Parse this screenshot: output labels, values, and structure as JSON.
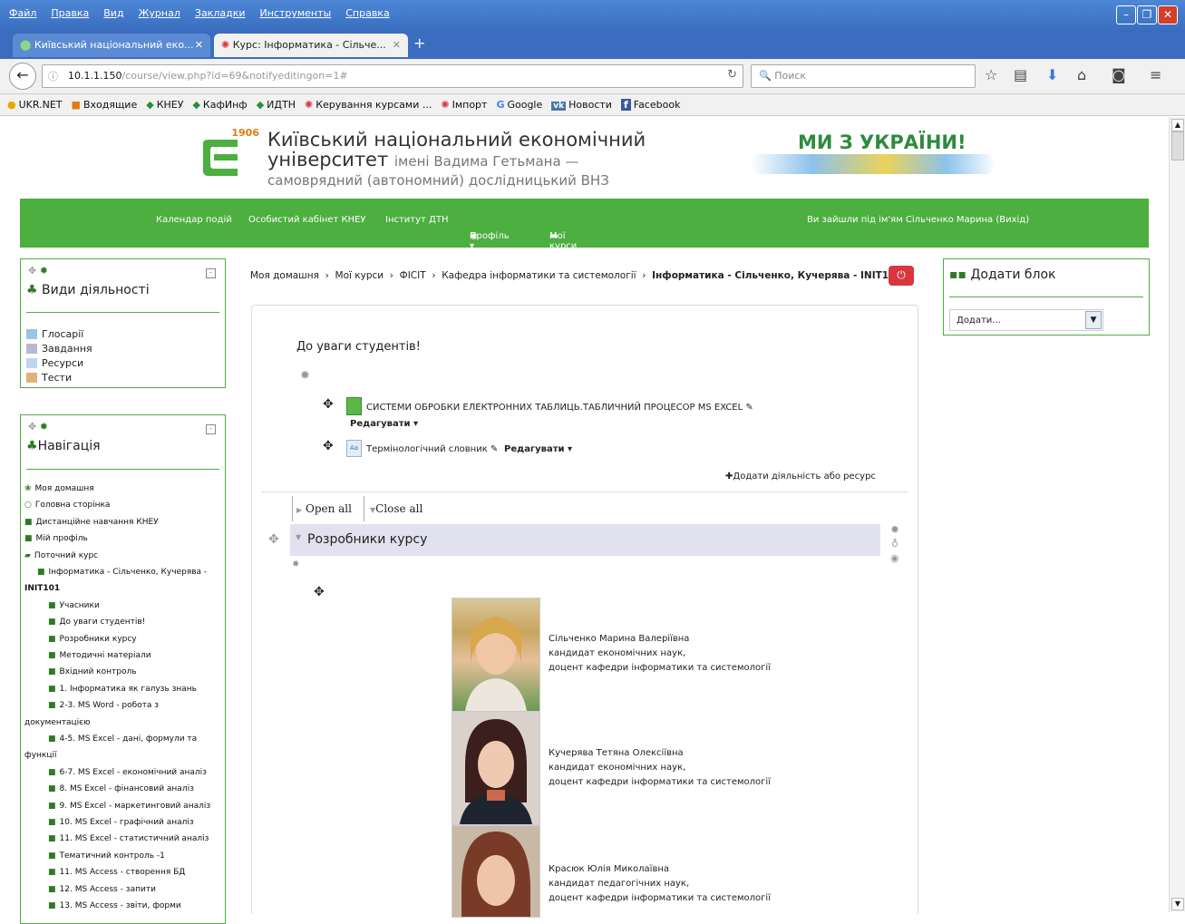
{
  "browser": {
    "menu": [
      "Файл",
      "Правка",
      "Вид",
      "Журнал",
      "Закладки",
      "Инструменты",
      "Справка"
    ],
    "tabs": [
      {
        "label": "Київський національний еко...",
        "active": false
      },
      {
        "label": "Курс: Інформатика - Сільче...",
        "active": true
      }
    ],
    "url_host": "10.1.1.150",
    "url_path": "/course/view.php?id=69&notifyeditingon=1#",
    "search_placeholder": "Поиск",
    "bookmarks": [
      "UKR.NET",
      "Входящие",
      "КНЕУ",
      "КафИнф",
      "ИДТН",
      "Керування курсами ...",
      "Імпорт",
      "Google",
      "Новости",
      "Facebook"
    ]
  },
  "header": {
    "logo_year": "1906",
    "uni_line1": "Київський національний економічний",
    "uni_line2_main": "університет",
    "uni_line2_sub": "імені Вадима Гетьмана —",
    "uni_line3": "самоврядний (автономний) дослідницький ВНЗ",
    "slogan": "МИ З УКРАЇНИ!"
  },
  "topnav": {
    "calendar": "Календар подій",
    "cabinet": "Особистий кабінет КНЕУ",
    "institute": "Інститут ДТН",
    "profile": "Профіль ▾",
    "courses": "Мої курси ▾",
    "login_info": "Ви зайшли під ім'ям Сільченко Марина (Вихід)"
  },
  "activities_block": {
    "title": "Види діяльності",
    "items": [
      "Глосарії",
      "Завдання",
      "Ресурси",
      "Тести"
    ]
  },
  "navigation_block": {
    "title": "Навігація",
    "items": [
      {
        "label": "Моя домашня",
        "indent": 0,
        "icon": "home"
      },
      {
        "label": "Головна сторінка",
        "indent": 0,
        "icon": "circle"
      },
      {
        "label": "Дистанційне навчання КНЕУ",
        "indent": 0,
        "icon": "folder"
      },
      {
        "label": "Мій профіль",
        "indent": 0,
        "icon": "folder"
      },
      {
        "label": "Поточний курс",
        "indent": 0,
        "icon": "folder-open"
      },
      {
        "label": "Інформатика - Сільченко, Кучерява -",
        "indent": 1,
        "icon": "folder"
      },
      {
        "label": "INIT101",
        "indent": 0,
        "icon": "none",
        "bold": true
      },
      {
        "label": "Учасники",
        "indent": 2,
        "icon": "folder"
      },
      {
        "label": "До уваги студентів!",
        "indent": 2,
        "icon": "folder"
      },
      {
        "label": "Розробники курсу",
        "indent": 2,
        "icon": "folder"
      },
      {
        "label": "Методичні матеріали",
        "indent": 2,
        "icon": "folder"
      },
      {
        "label": "Вхідний контроль",
        "indent": 2,
        "icon": "folder"
      },
      {
        "label": "1. Інформатика як галузь знань",
        "indent": 2,
        "icon": "folder"
      },
      {
        "label": "2-3. MS Word - робота з",
        "indent": 2,
        "icon": "folder"
      },
      {
        "label": "документацією",
        "indent": 0,
        "icon": "none"
      },
      {
        "label": "4-5. MS Excel - дані, формули та",
        "indent": 2,
        "icon": "folder"
      },
      {
        "label": "функції",
        "indent": 0,
        "icon": "none"
      },
      {
        "label": "6-7. MS Excel - економічний аналіз",
        "indent": 2,
        "icon": "folder"
      },
      {
        "label": "8. MS Excel - фінансовий аналіз",
        "indent": 2,
        "icon": "folder"
      },
      {
        "label": "9. MS Excel - маркетинговий аналіз",
        "indent": 2,
        "icon": "folder"
      },
      {
        "label": "10. MS Excel - графічний аналіз",
        "indent": 2,
        "icon": "folder"
      },
      {
        "label": "11. MS Excel - статистичний аналіз",
        "indent": 2,
        "icon": "folder"
      },
      {
        "label": "Тематичний контроль -1",
        "indent": 2,
        "icon": "folder"
      },
      {
        "label": "11. MS Access - створення БД",
        "indent": 2,
        "icon": "folder"
      },
      {
        "label": "12. MS Access - запити",
        "indent": 2,
        "icon": "folder"
      },
      {
        "label": "13. MS Access - звіти, форми",
        "indent": 2,
        "icon": "folder"
      }
    ]
  },
  "breadcrumb": {
    "items": [
      "Моя домашня",
      "Мої курси",
      "ФІСІТ",
      "Кафедра інформатики та системології"
    ],
    "current": "Інформатика - Сільченко, Кучерява - INIT101"
  },
  "add_block": {
    "title": "Додати блок",
    "select_value": "Додати..."
  },
  "main": {
    "notice_title": "До уваги студентів!",
    "resource1": "СИСТЕМИ ОБРОБКИ ЕЛЕКТРОННИХ ТАБЛИЦЬ.ТАБЛИЧНИЙ ПРОЦЕСОР MS EXCEL",
    "resource2": "Термінологічний словник",
    "edit_label": "Редагувати ▾",
    "add_activity": "Додати діяльність або ресурс",
    "open_all": "Open all",
    "close_all": "Close all",
    "section_title": "Розробники курсу",
    "developers": [
      {
        "name": "Сільченко Марина Валеріївна",
        "degree": "кандидат економічних наук,",
        "position": "доцент кафедри інформатики та системології"
      },
      {
        "name": "Кучерява Тетяна Олексіївна",
        "degree": "кандидат економічних наук,",
        "position": "доцент кафедри інформатики та системології"
      },
      {
        "name": "Красюк Юлія Миколаївна",
        "degree": "кандидат педагогічних наук,",
        "position": "доцент кафедри інформатики та системології"
      }
    ]
  },
  "colors": {
    "green": "#4caf3f",
    "firefox_blue": "#3b6fc0",
    "section_bg": "#e2e1f0",
    "logout_red": "#d9363e"
  }
}
